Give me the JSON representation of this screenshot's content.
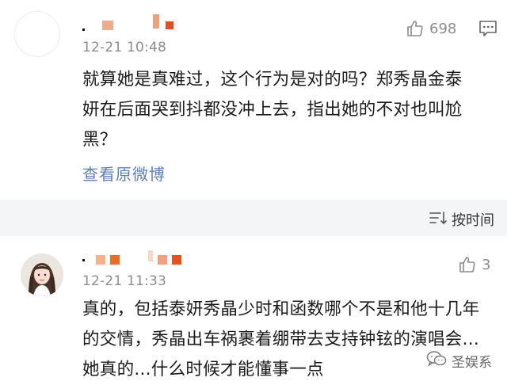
{
  "comment1": {
    "avatar_icon": "avatar-placeholder",
    "name_blocks": [
      "#f4a98a",
      "#f0a07d",
      "#e74c1c"
    ],
    "time": "12-21 10:48",
    "like_icon": "thumbs-up-icon",
    "like_count": "698",
    "comment_icon": "speech-bubble-icon",
    "text_lines": [
      "就算她是真难过，这个行为是对的吗？郑秀晶金泰",
      "妍在后面哭到抖都没冲上去，指出她的不对也叫尬",
      "黑？"
    ],
    "view_original": "查看原微博"
  },
  "sort_bar": {
    "icon": "sort-lines-icon",
    "label": "按时间"
  },
  "comment2": {
    "avatar_icon": "girl-avatar-icon",
    "name_blocks": [
      "#f8b18a",
      "#f06a2a",
      "#fbd7c2",
      "#f2a07a",
      "#e8501c"
    ],
    "time": "12-21 11:33",
    "like_icon": "thumbs-up-icon",
    "like_count": "3",
    "text_lines": [
      "真的，包括泰妍秀晶少时和函数哪个不是和他十几年",
      "的交情，秀晶出车祸裹着绷带去支持钟铉的演唱会...",
      "她真的...什么时候才能懂事一点"
    ]
  },
  "watermark": {
    "icon": "wechat-icon",
    "label": "圣娱系"
  },
  "colors": {
    "text_primary": "#1a1a1a",
    "text_secondary": "#8c8c8c",
    "link": "#5e7fb4",
    "band": "#f4f5f7"
  }
}
